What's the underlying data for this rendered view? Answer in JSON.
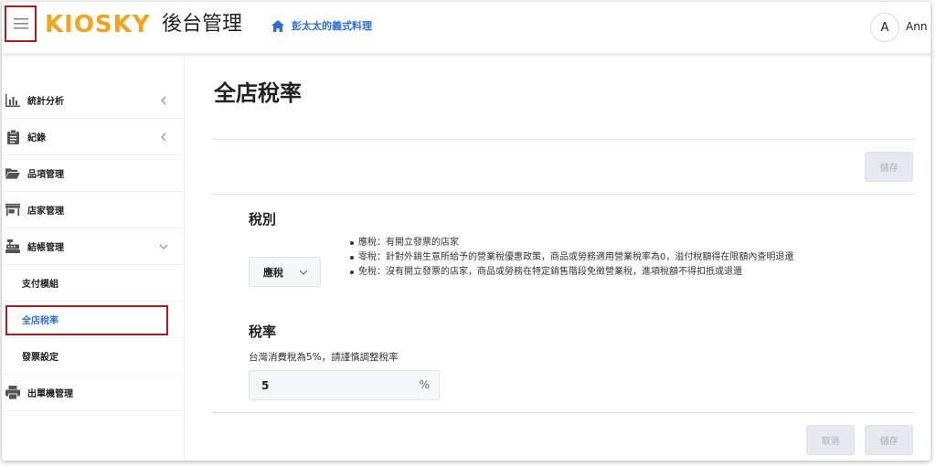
{
  "header": {
    "logo": "KIOSKY",
    "title": "後台管理",
    "store_name": "彭太太的義式料理",
    "avatar_initial": "A",
    "username": "Ann"
  },
  "sidebar": {
    "items": [
      {
        "label": "統計分析",
        "icon": "bar-chart-icon"
      },
      {
        "label": "紀錄",
        "icon": "clipboard-icon"
      },
      {
        "label": "品項管理",
        "icon": "folder-open-icon"
      },
      {
        "label": "店家管理",
        "icon": "store-icon"
      },
      {
        "label": "結帳管理",
        "icon": "cash-register-icon"
      },
      {
        "label": "出單機管理",
        "icon": "printer-icon"
      }
    ],
    "sub_items": [
      {
        "label": "支付模組"
      },
      {
        "label": "全店稅率"
      },
      {
        "label": "發票設定"
      }
    ],
    "active_sub": "全店稅率"
  },
  "main": {
    "page_title": "全店稅率",
    "save_label": "儲存",
    "tax_type": {
      "section_title": "稅別",
      "selected": "應稅",
      "descriptions": [
        "應稅：有開立發票的店家",
        "零稅：針對外銷生意所給予的營業稅優惠政策，商品或勞務適用營業稅率為0，溢付稅額得在限額內查明退還",
        "免稅：沒有開立發票的店家，商品或勞務在特定銷售階段免徵營業稅，進項稅額不得扣抵或退還"
      ]
    },
    "tax_rate": {
      "section_title": "稅率",
      "hint": "台灣消費稅為5%，請謹慎調整稅率",
      "value": "5",
      "unit": "%"
    },
    "footer": {
      "cancel_label": "取消",
      "save_label": "儲存"
    }
  },
  "colors": {
    "logo": "#f5a31a",
    "accent": "#2f6fd6",
    "highlight_border": "#b01c1c",
    "disabled_button": "#e6e9ef"
  }
}
